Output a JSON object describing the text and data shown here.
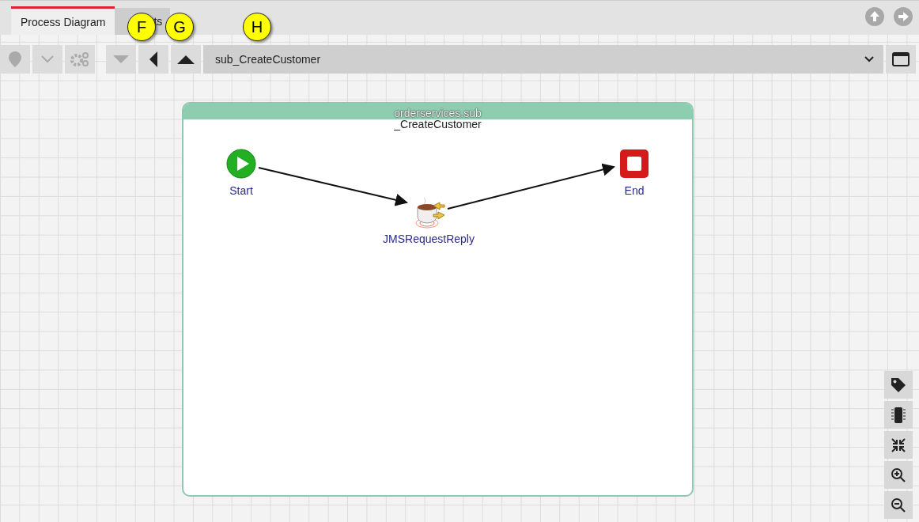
{
  "tabs": [
    {
      "label": "Process Diagram",
      "selected": true
    },
    {
      "label": "ts",
      "selected": false
    }
  ],
  "callouts": [
    "F",
    "G",
    "H"
  ],
  "toolbar": {
    "path": "sub_CreateCustomer"
  },
  "diagram": {
    "title_lines": [
      "orderservices.sub",
      "_CreateCustomer"
    ],
    "nodes": [
      {
        "kind": "start",
        "label": "Start"
      },
      {
        "kind": "activity",
        "label": "JMSRequestReply"
      },
      {
        "kind": "end",
        "label": "End"
      }
    ]
  }
}
